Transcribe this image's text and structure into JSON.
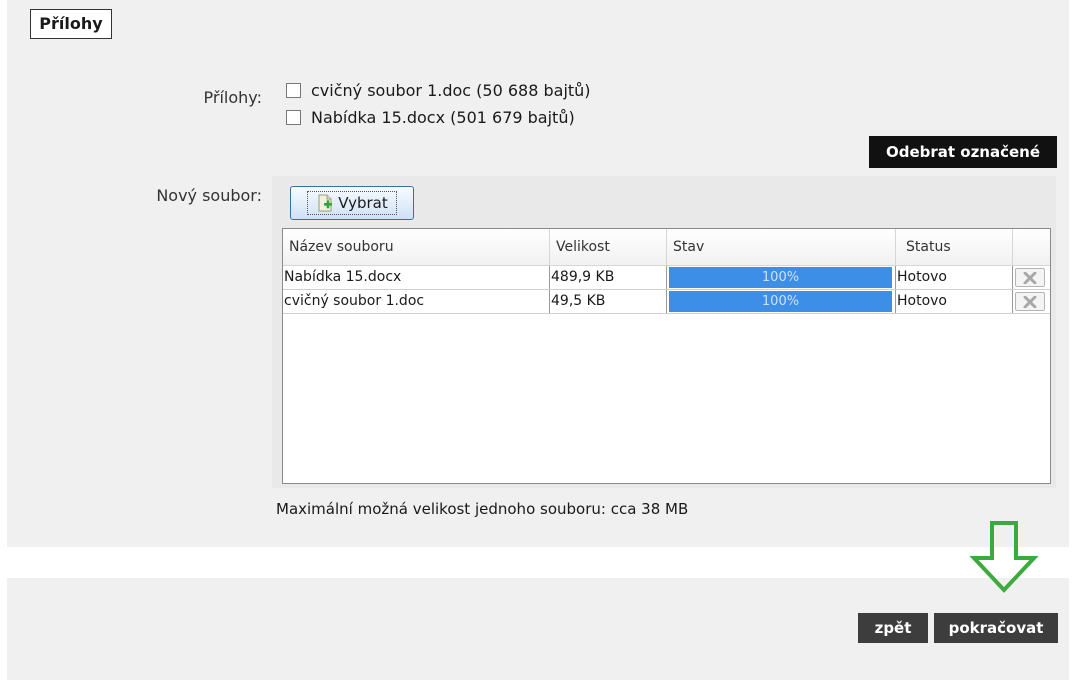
{
  "section": {
    "title": "Přílohy"
  },
  "attachments": {
    "label": "Přílohy:",
    "items": [
      {
        "text": "cvičný soubor 1.doc (50 688 bajtů)"
      },
      {
        "text": "Nabídka 15.docx (501 679 bajtů)"
      }
    ],
    "remove_label": "Odebrat označené"
  },
  "new_file": {
    "label": "Nový soubor:",
    "choose_label": "Vybrat"
  },
  "table": {
    "columns": [
      "Název souboru",
      "Velikost",
      "Stav",
      "Status"
    ],
    "rows": [
      {
        "name": "Nabídka 15.docx",
        "size": "489,9 KB",
        "progress_text": "100%",
        "progress": 1.0,
        "status": "Hotovo"
      },
      {
        "name": "cvičný soubor 1.doc",
        "size": "49,5 KB",
        "progress_text": "100%",
        "progress": 1.0,
        "status": "Hotovo"
      }
    ]
  },
  "max_size_note": "Maximální možná velikost jednoho souboru: cca 38 MB",
  "nav": {
    "back_label": "zpět",
    "continue_label": "pokračovat"
  },
  "colors": {
    "progress": "#3d8ee6",
    "arrow": "#3caa3c",
    "dark_button": "#111111"
  }
}
